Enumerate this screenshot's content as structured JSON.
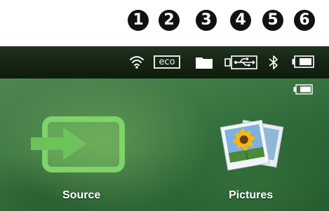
{
  "callouts": [
    "1",
    "2",
    "3",
    "4",
    "5",
    "6"
  ],
  "statusbar": {
    "eco_label": "eco",
    "icons": [
      "wifi-icon",
      "eco-mode-icon",
      "folder-icon",
      "usb-connection-icon",
      "bluetooth-icon",
      "battery-icon"
    ]
  },
  "main": {
    "menu": [
      {
        "label": "Source",
        "icon": "source-input-icon"
      },
      {
        "label": "Pictures",
        "icon": "pictures-icon"
      }
    ],
    "battery_icon": "battery-icon"
  },
  "colors": {
    "status_bg": "#172715",
    "menu_green": "#6cc35a",
    "text": "#ffffff"
  }
}
